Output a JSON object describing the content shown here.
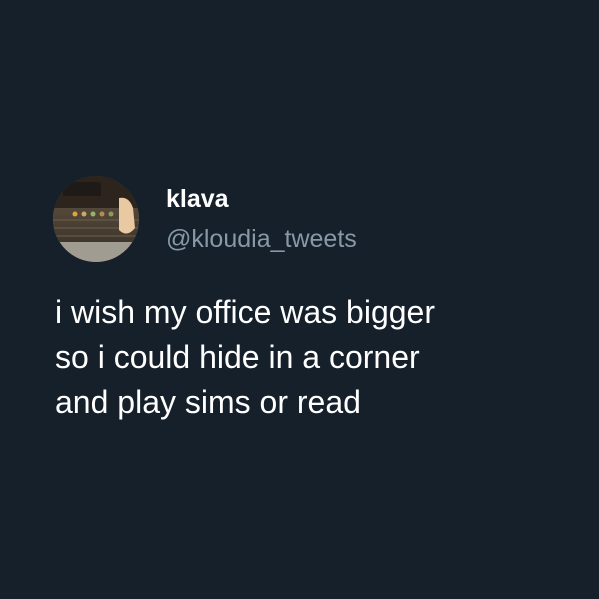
{
  "tweet": {
    "display_name": "klava",
    "handle": "@kloudia_tweets",
    "lines": [
      "i wish my office was bigger",
      "so i could hide in a corner",
      "and play sims or read"
    ]
  },
  "colors": {
    "background": "#15202b",
    "name": "#ffffff",
    "handle": "#8899a6",
    "text": "#ffffff"
  }
}
